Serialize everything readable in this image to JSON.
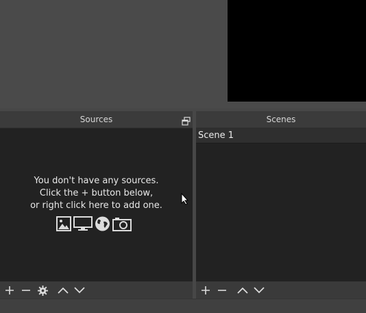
{
  "sources": {
    "title": "Sources",
    "empty_line1": "You don't have any sources.",
    "empty_line2": "Click the + button below,",
    "empty_line3": "or right click here to add one.",
    "icons": [
      "image-icon",
      "display-icon",
      "globe-icon",
      "camera-icon"
    ],
    "toolbar": [
      "add-icon",
      "remove-icon",
      "gear-icon",
      "move-up-icon",
      "move-down-icon"
    ]
  },
  "scenes": {
    "title": "Scenes",
    "items": [
      {
        "label": "Scene 1"
      }
    ],
    "toolbar": [
      "add-icon",
      "remove-icon",
      "move-up-icon",
      "move-down-icon"
    ]
  },
  "colors": {
    "background": "#474747",
    "dock_body": "#222222",
    "dock_title": "#3b3b3b",
    "preview_canvas": "#000000",
    "icon": "#dcdcdc"
  }
}
